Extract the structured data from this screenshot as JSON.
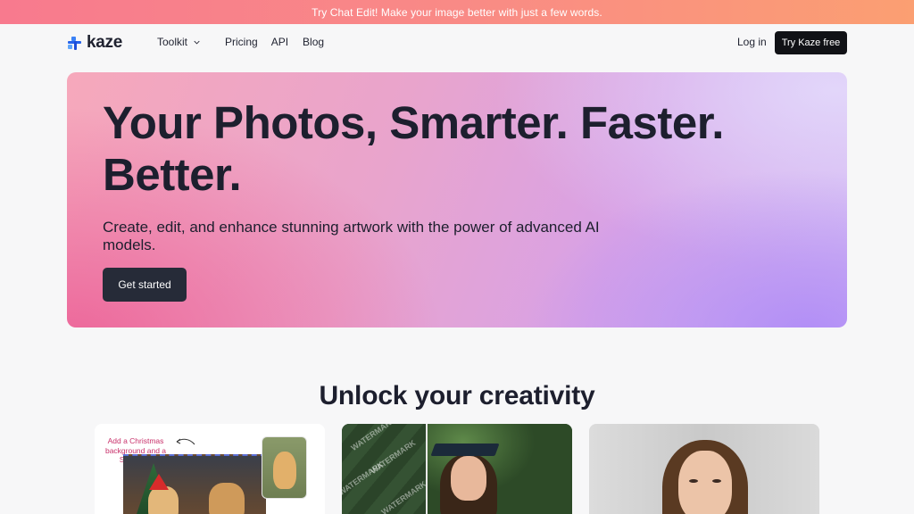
{
  "promo": {
    "text": "Try Chat Edit!  Make your image better with just a few words."
  },
  "nav": {
    "logo_text": "kaze",
    "links": [
      "Toolkit",
      "Pricing",
      "API",
      "Blog"
    ],
    "login": "Log in",
    "cta": "Try Kaze free"
  },
  "hero": {
    "title": "Your Photos, Smarter. Faster. Better.",
    "subtitle": "Create, edit, and enhance stunning artwork with the power of advanced AI models.",
    "cta": "Get started"
  },
  "section": {
    "title": "Unlock your creativity"
  },
  "cards": {
    "card1_note": "Add a Christmas background and a Santa hat",
    "card2_watermark": "WATERMARK"
  }
}
